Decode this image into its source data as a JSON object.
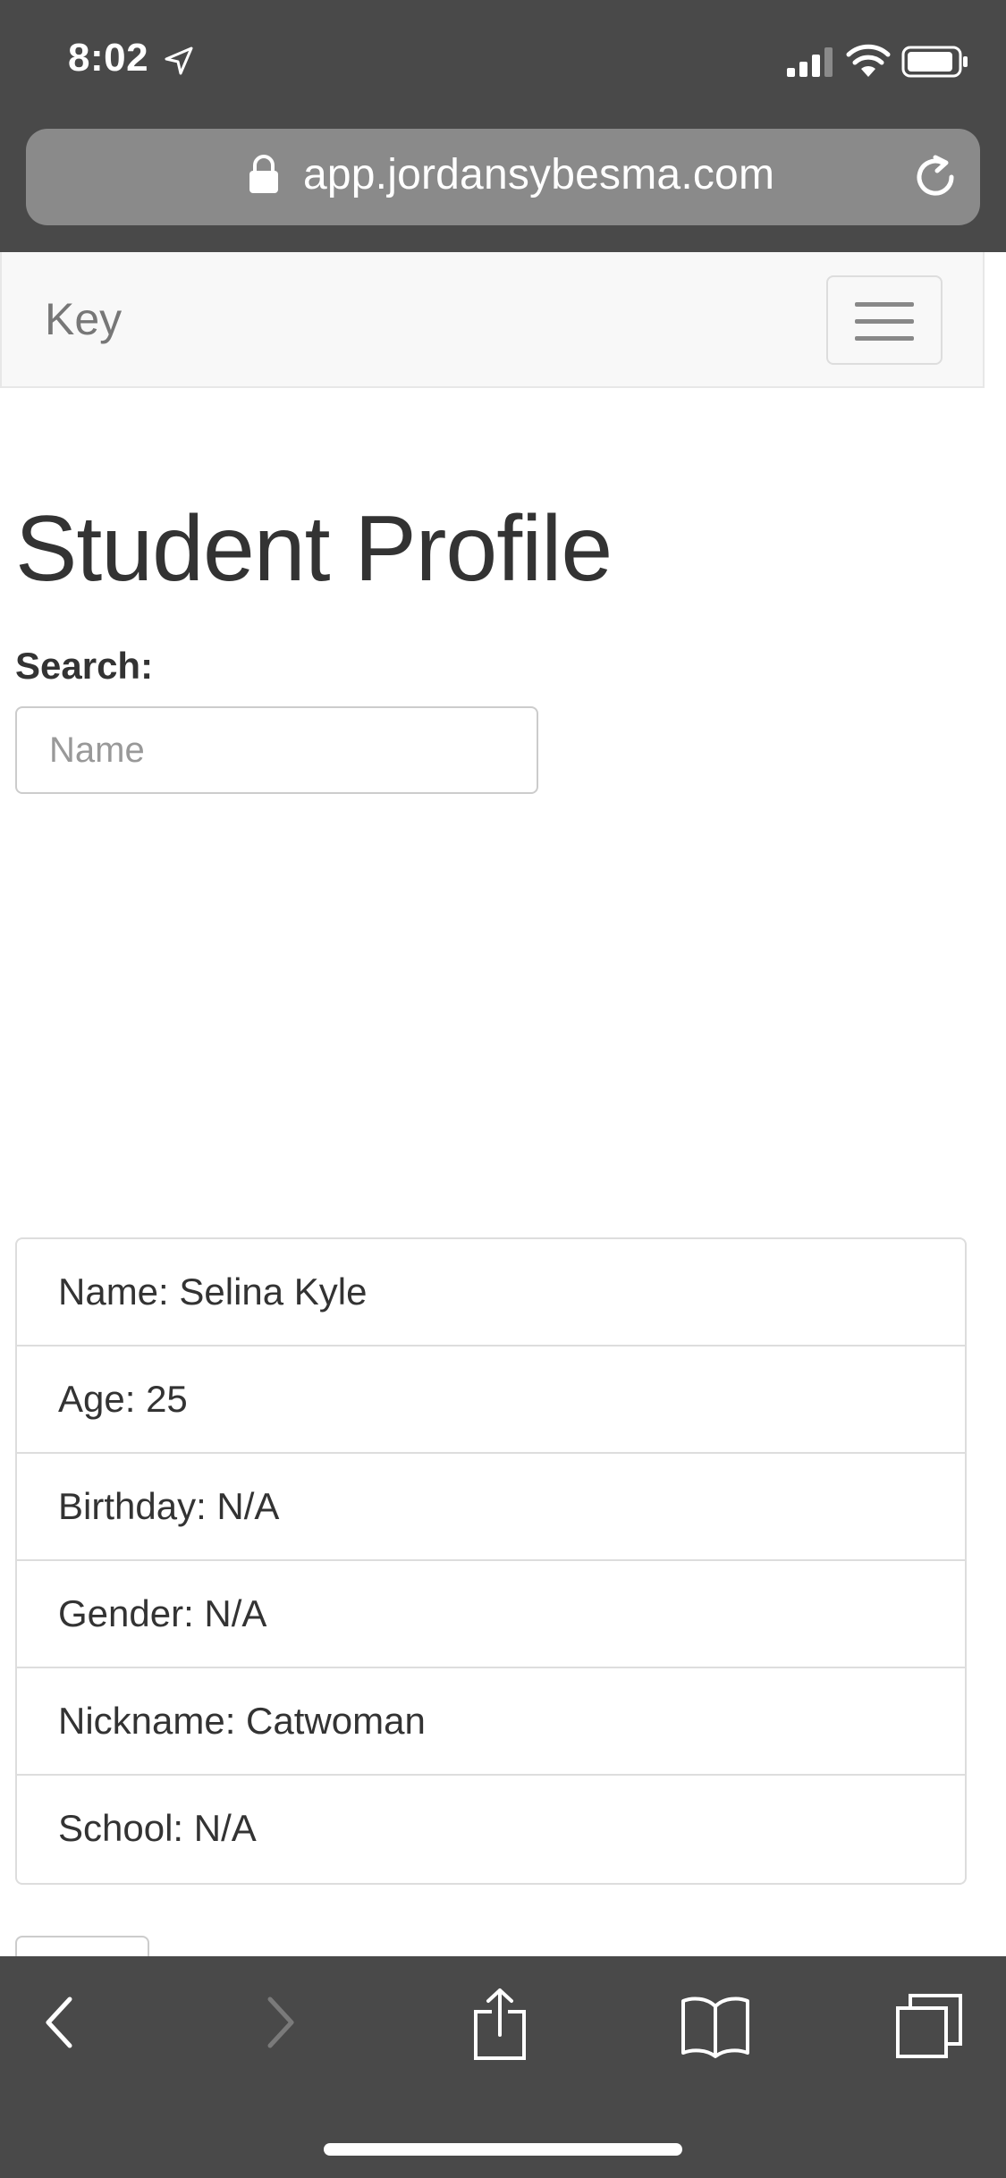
{
  "status_bar": {
    "time": "8:02",
    "icons": [
      "location-arrow-icon",
      "cellular-signal-icon",
      "wifi-icon",
      "battery-icon"
    ]
  },
  "address_bar": {
    "url": "app.jordansybesma.com",
    "icons": [
      "lock-icon",
      "reload-icon"
    ]
  },
  "navbar": {
    "brand": "Key",
    "toggle_icon": "hamburger-menu-icon"
  },
  "main": {
    "title": "Student Profile",
    "search": {
      "label": "Search:",
      "placeholder": "Name",
      "value": ""
    },
    "profile_items": [
      {
        "label": "Name: Selina Kyle"
      },
      {
        "label": "Age: 25"
      },
      {
        "label": "Birthday: N/A"
      },
      {
        "label": "Gender: N/A"
      },
      {
        "label": "Nickname: Catwoman"
      },
      {
        "label": "School: N/A"
      }
    ]
  },
  "toolbar": {
    "icons": [
      "back-chevron-icon",
      "forward-chevron-icon",
      "share-icon",
      "bookmarks-icon",
      "tabs-icon"
    ],
    "forward_enabled": false
  },
  "colors": {
    "browser_chrome": "#494949",
    "url_field": "#8a8a8a",
    "navbar_bg": "#f8f8f8",
    "text": "#333333",
    "border": "#dddddd"
  }
}
